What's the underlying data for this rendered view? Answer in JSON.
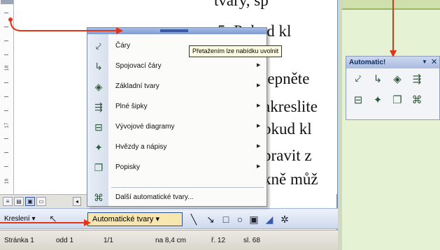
{
  "document": {
    "lines": [
      "tvary, sp",
      "5.  Pokud kl",
      "lepněte",
      "akreslite",
      "okud kl",
      "pravit z",
      "kně můž"
    ]
  },
  "ruler": {
    "numbers": [
      "18",
      "17",
      "16"
    ]
  },
  "view_buttons": [
    "≡",
    "▤",
    "▣",
    "▭",
    "◂"
  ],
  "menu": {
    "items": [
      {
        "label": "Čáry",
        "icon": "lines-icon",
        "glyph": "⤦",
        "has_submenu": false
      },
      {
        "label": "Spojovací čáry",
        "icon": "connectors-icon",
        "glyph": "↳",
        "has_submenu": true
      },
      {
        "label": "Základní tvary",
        "icon": "basic-shapes-icon",
        "glyph": "◈",
        "has_submenu": true
      },
      {
        "label": "Plné šipky",
        "icon": "block-arrows-icon",
        "glyph": "⇶",
        "has_submenu": true
      },
      {
        "label": "Vývojové diagramy",
        "icon": "flowchart-icon",
        "glyph": "⊟",
        "has_submenu": true
      },
      {
        "label": "Hvězdy a nápisy",
        "icon": "stars-banners-icon",
        "glyph": "✦",
        "has_submenu": true
      },
      {
        "label": "Popisky",
        "icon": "callouts-icon",
        "glyph": "❐",
        "has_submenu": true
      },
      {
        "label": "Další automatické tvary...",
        "icon": "more-autoshapes-icon",
        "glyph": "⌘",
        "has_submenu": false
      }
    ]
  },
  "tooltip": {
    "text": "Přetažením lze nabídku uvolnit"
  },
  "drawing_toolbar": {
    "draw_label": "Kreslení ▾",
    "autoshapes_label": "Automatické tvary ▾",
    "tools": [
      "line-icon",
      "arrow-icon",
      "rectangle-icon",
      "oval-icon",
      "textbox-icon",
      "wordart-icon",
      "diagram-icon"
    ]
  },
  "status_bar": {
    "page": "Stránka 1",
    "section": "odd 1",
    "pages": "1/1",
    "position": "na 8,4 cm",
    "line": "ř. 12",
    "column": "sl. 68"
  },
  "palette": {
    "title": "Automatic!",
    "dropdown": "▼",
    "close": "✕",
    "icons": [
      "lines-icon",
      "connectors-icon",
      "basic-shapes-icon",
      "block-arrows-icon",
      "flowchart-icon",
      "stars-banners-icon",
      "callouts-icon",
      "more-autoshapes-icon"
    ],
    "glyphs": [
      "⤦",
      "↳",
      "◈",
      "⇶",
      "⊟",
      "✦",
      "❐",
      "⌘"
    ]
  },
  "colors": {
    "callout": "#e33418",
    "accent": "#2a4f9a"
  }
}
